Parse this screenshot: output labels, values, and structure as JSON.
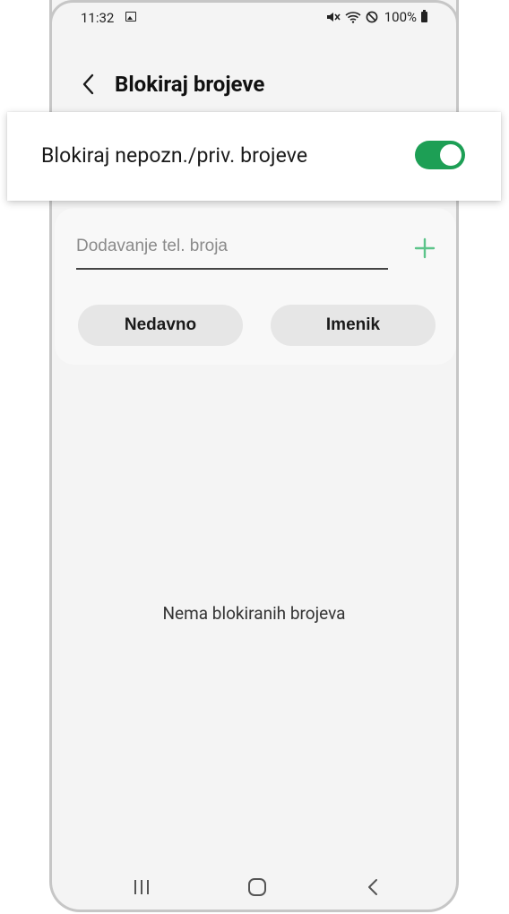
{
  "status_bar": {
    "time": "11:32",
    "battery_percent": "100%",
    "icons": [
      "image-icon",
      "mute-icon",
      "wifi-icon",
      "do-not-disturb-icon",
      "battery-icon"
    ]
  },
  "header": {
    "title": "Blokiraj brojeve"
  },
  "block_unknown": {
    "label": "Blokiraj nepozn./priv. brojeve",
    "enabled": true,
    "accent_color": "#1d9f55"
  },
  "add_number": {
    "placeholder": "Dodavanje tel. broja",
    "value": "",
    "recent_button": "Nedavno",
    "contacts_button": "Imenik"
  },
  "blocked_list": {
    "empty_message": "Nema blokiranih brojeva"
  },
  "nav_bar": {
    "buttons": [
      "recents-icon",
      "home-icon",
      "back-icon"
    ]
  }
}
